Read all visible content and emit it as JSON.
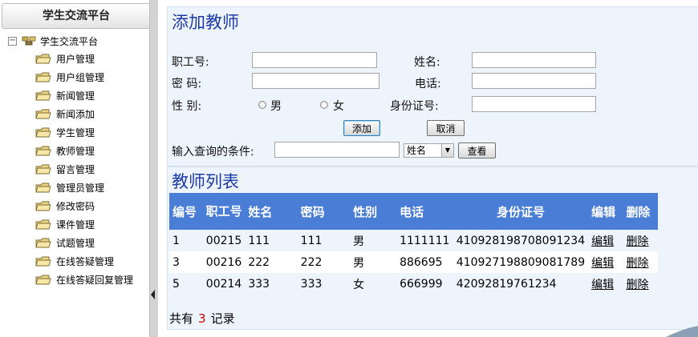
{
  "sidebar": {
    "header_title": "学生交流平台",
    "root": {
      "expander": "−",
      "label": "学生交流平台"
    },
    "items": [
      {
        "label": "用户管理"
      },
      {
        "label": "用户组管理"
      },
      {
        "label": "新闻管理"
      },
      {
        "label": "新闻添加"
      },
      {
        "label": "学生管理"
      },
      {
        "label": "教师管理"
      },
      {
        "label": "留言管理"
      },
      {
        "label": "管理员管理"
      },
      {
        "label": "修改密码"
      },
      {
        "label": "课件管理"
      },
      {
        "label": "试题管理"
      },
      {
        "label": "在线答疑管理"
      },
      {
        "label": "在线答疑回复管理"
      }
    ]
  },
  "add_form": {
    "title": "添加教师",
    "employee_id_label": "职工号:",
    "employee_id_value": "",
    "name_label": "姓名:",
    "name_value": "",
    "password_label": "密 码:",
    "password_value": "",
    "phone_label": "电话:",
    "phone_value": "",
    "gender_label": "性 别:",
    "gender_male": "男",
    "gender_female": "女",
    "id_card_label": "身份证号:",
    "id_card_value": "",
    "add_button": "添加",
    "cancel_button": "取消",
    "query_label": "输入查询的条件:",
    "query_value": "",
    "query_field_selected": "姓名",
    "search_button": "查看"
  },
  "teacher_list": {
    "title": "教师列表",
    "columns": [
      "编号",
      "职工号",
      "姓名",
      "密码",
      "性别",
      "电话",
      "身份证号",
      "编辑",
      "删除"
    ],
    "rows": [
      {
        "id": "1",
        "emp_no": "00215",
        "name": "111",
        "password": "111",
        "gender": "男",
        "phone": "1111111",
        "id_card": "410928198708091234",
        "edit": "编辑",
        "delete": "删除"
      },
      {
        "id": "3",
        "emp_no": "00216",
        "name": "222",
        "password": "222",
        "gender": "男",
        "phone": "886695",
        "id_card": "410927198809081789",
        "edit": "编辑",
        "delete": "删除"
      },
      {
        "id": "5",
        "emp_no": "00214",
        "name": "333",
        "password": "333",
        "gender": "女",
        "phone": "666999",
        "id_card": "42092819761234",
        "edit": "编辑",
        "delete": "删除"
      }
    ],
    "footer_prefix": "共有",
    "footer_count": "3",
    "footer_suffix": "记录"
  },
  "colors": {
    "header_blue": "#4a7dd6",
    "title_blue": "#1d3ba8",
    "panel_bg": "#eef4fb",
    "count_red": "#cc0000"
  },
  "icons": {
    "root": "network-icon",
    "item": "folder-icon"
  }
}
